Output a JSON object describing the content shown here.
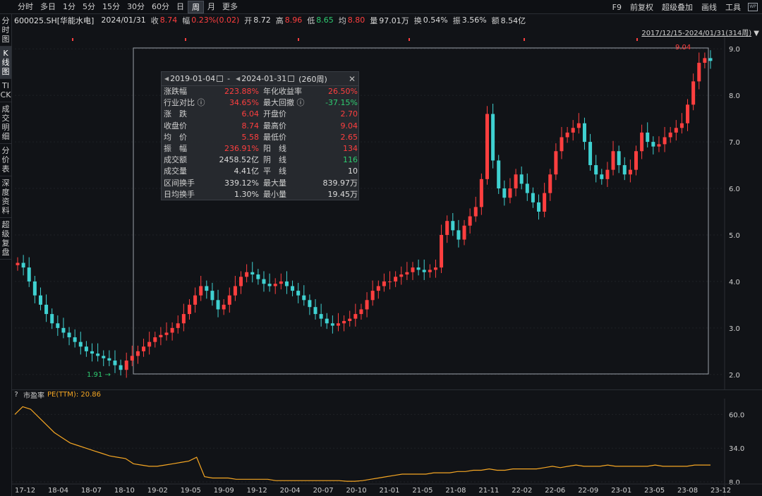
{
  "toolbar": {
    "periods": [
      "分时",
      "多日",
      "1分",
      "5分",
      "15分",
      "30分",
      "60分",
      "日",
      "周",
      "月",
      "更多"
    ],
    "active_period_index": 8,
    "right_tools": [
      "F9",
      "前复权",
      "超级叠加",
      "画线",
      "工具"
    ],
    "wp_icon": "WP"
  },
  "info": {
    "code": "600025.SH[华能水电]",
    "date": "2024/01/31",
    "close_label": "收",
    "close": "8.74",
    "change_label": "幅",
    "change": "0.23%(0.02)",
    "open_label": "开",
    "open": "8.72",
    "high_label": "高",
    "high": "8.96",
    "low_label": "低",
    "low": "8.65",
    "avg_label": "均",
    "avg": "8.80",
    "vol_label": "量",
    "vol": "97.01万",
    "turnover_label": "换",
    "turnover": "0.54%",
    "amp_label": "振",
    "amp": "3.56%",
    "amount_label": "额",
    "amount": "8.54亿"
  },
  "left_tabs": [
    "分时图",
    "K线图",
    "TICK",
    "成交明细",
    "分价表",
    "深度资料",
    "超级复盘"
  ],
  "left_tabs_active": 1,
  "range": {
    "text": "2017/12/15-2024/01/31(314周)",
    "dropdown_icon": "▼"
  },
  "stats": {
    "start_date": "2019-01-04",
    "end_date": "2024-01-31",
    "weeks": "(260周)",
    "sep": "-",
    "rows": [
      {
        "k1": "涨跌幅",
        "v1": "223.88%",
        "c1": "red",
        "k2": "年化收益率",
        "v2": "26.50%",
        "c2": "red"
      },
      {
        "k1": "行业对比 ⓘ",
        "v1": "34.65%",
        "c1": "red",
        "k2": "最大回撤 ⓘ",
        "v2": "-37.15%",
        "c2": "green"
      },
      {
        "k1": "涨　跌",
        "v1": "6.04",
        "c1": "red",
        "k2": "开盘价",
        "v2": "2.70",
        "c2": "red"
      },
      {
        "k1": "收盘价",
        "v1": "8.74",
        "c1": "red",
        "k2": "最高价",
        "v2": "9.04",
        "c2": "red"
      },
      {
        "k1": "均　价",
        "v1": "5.58",
        "c1": "red",
        "k2": "最低价",
        "v2": "2.65",
        "c2": "red"
      },
      {
        "k1": "振　幅",
        "v1": "236.91%",
        "c1": "red",
        "k2": "阳　线",
        "v2": "134",
        "c2": "red"
      },
      {
        "k1": "成交额",
        "v1": "2458.52亿",
        "c1": "white",
        "k2": "阴　线",
        "v2": "116",
        "c2": "green"
      },
      {
        "k1": "成交量",
        "v1": "4.41亿",
        "c1": "white",
        "k2": "平　线",
        "v2": "10",
        "c2": "white"
      },
      {
        "k1": "区间换手",
        "v1": "339.12%",
        "c1": "white",
        "k2": "最大量",
        "v2": "839.97万",
        "c2": "white"
      },
      {
        "k1": "日均换手",
        "v1": "1.30%",
        "c1": "white",
        "k2": "最小量",
        "v2": "19.45万",
        "c2": "white"
      }
    ]
  },
  "price_axis": [
    "9.0",
    "8.0",
    "7.0",
    "6.0",
    "5.0",
    "4.0",
    "3.0",
    "2.0"
  ],
  "pe_axis": [
    "60.0",
    "34.0",
    "8.0"
  ],
  "time_axis": [
    "17-12",
    "18-04",
    "18-07",
    "18-10",
    "19-02",
    "19-05",
    "19-09",
    "19-12",
    "20-04",
    "20-07",
    "20-10",
    "21-01",
    "21-05",
    "21-08",
    "21-11",
    "22-02",
    "22-06",
    "22-09",
    "23-01",
    "23-05",
    "23-08",
    "23-12"
  ],
  "markers": {
    "high": "9.04",
    "low": "1.91"
  },
  "pe_header": {
    "q": "?",
    "title": "市盈率",
    "pe": "PE(TTM): 20.86"
  },
  "colors": {
    "up": "#ff3f3f",
    "down": "#3fd1d1",
    "pe_line": "#f5a623",
    "bg": "#111317"
  },
  "chart_data": {
    "type": "candlestick",
    "price_ylim": [
      1.8,
      9.2
    ],
    "pe_ylim": [
      8,
      70
    ],
    "closes": [
      4.4,
      4.3,
      4.0,
      3.7,
      3.5,
      3.3,
      3.1,
      3.0,
      2.9,
      2.8,
      2.7,
      2.6,
      2.5,
      2.45,
      2.4,
      2.35,
      2.3,
      2.2,
      2.1,
      2.3,
      2.4,
      2.5,
      2.6,
      2.7,
      2.8,
      2.85,
      2.9,
      3.0,
      3.1,
      3.3,
      3.5,
      3.7,
      3.9,
      3.8,
      3.6,
      3.4,
      3.5,
      3.7,
      3.9,
      4.1,
      4.2,
      4.15,
      4.05,
      3.95,
      3.9,
      3.95,
      4.0,
      3.9,
      3.8,
      3.7,
      3.6,
      3.45,
      3.3,
      3.2,
      3.1,
      3.05,
      3.1,
      3.15,
      3.2,
      3.3,
      3.4,
      3.6,
      3.8,
      3.9,
      4.0,
      4.0,
      4.1,
      4.15,
      4.2,
      4.3,
      4.25,
      4.2,
      4.25,
      4.3,
      5.0,
      5.3,
      5.1,
      4.9,
      5.2,
      5.4,
      5.6,
      6.2,
      7.6,
      6.6,
      6.0,
      5.8,
      6.0,
      6.3,
      6.1,
      5.9,
      5.7,
      5.5,
      5.9,
      6.3,
      6.8,
      7.1,
      7.2,
      7.3,
      7.4,
      7.0,
      6.5,
      6.3,
      6.2,
      6.4,
      6.8,
      6.5,
      6.3,
      6.4,
      6.8,
      7.2,
      7.0,
      6.9,
      6.95,
      7.1,
      7.2,
      7.3,
      7.4,
      7.8,
      8.3,
      8.7,
      8.8,
      8.74
    ],
    "pe_values": [
      60,
      66,
      64,
      58,
      52,
      46,
      42,
      38,
      36,
      34,
      32,
      30,
      28,
      27,
      26,
      22,
      21,
      20,
      20,
      21,
      22,
      23,
      24,
      27,
      12,
      11,
      11,
      11,
      10,
      10,
      10,
      10,
      10,
      9,
      9,
      9,
      9,
      9,
      9,
      9,
      9,
      9,
      8.5,
      8.5,
      9,
      10,
      11,
      12,
      13,
      14,
      14,
      14,
      14,
      15,
      15,
      15,
      16,
      16,
      17,
      17,
      18,
      17,
      17,
      18,
      18,
      18,
      18,
      19,
      20,
      19,
      20,
      21,
      20,
      20,
      20,
      21,
      20,
      20,
      20,
      20,
      20,
      21,
      20,
      20,
      20,
      20,
      21,
      21,
      21
    ]
  }
}
